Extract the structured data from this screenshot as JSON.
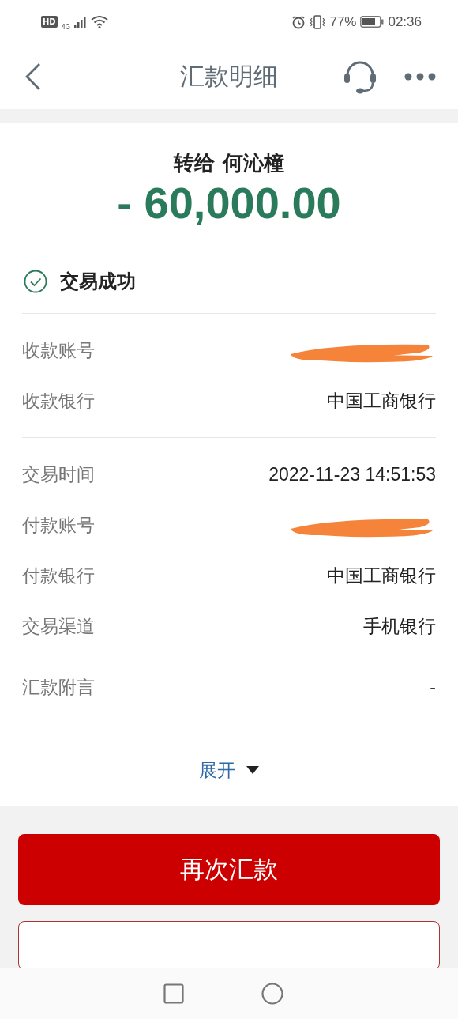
{
  "status_bar": {
    "hd": "HD",
    "network": "4G",
    "battery_percent": "77%",
    "time": "02:36"
  },
  "header": {
    "title": "汇款明细"
  },
  "summary": {
    "recipient_line": "转给 何沁橦",
    "amount": "- 60,000.00"
  },
  "status": {
    "label": "交易成功"
  },
  "groups": [
    {
      "rows": [
        {
          "label": "收款账号",
          "kind": "redacted"
        },
        {
          "label": "收款银行",
          "kind": "text",
          "value": "中国工商银行"
        }
      ]
    },
    {
      "rows": [
        {
          "label": "交易时间",
          "kind": "text",
          "value": "2022-11-23 14:51:53"
        },
        {
          "label": "付款账号",
          "kind": "redacted"
        },
        {
          "label": "付款银行",
          "kind": "text",
          "value": "中国工商银行"
        },
        {
          "label": "交易渠道",
          "kind": "text",
          "value": "手机银行"
        },
        {
          "label": "汇款附言",
          "kind": "text",
          "value": "-"
        }
      ]
    }
  ],
  "expand": {
    "label": "展开",
    "expanded": false
  },
  "primary_button": "再次汇款"
}
